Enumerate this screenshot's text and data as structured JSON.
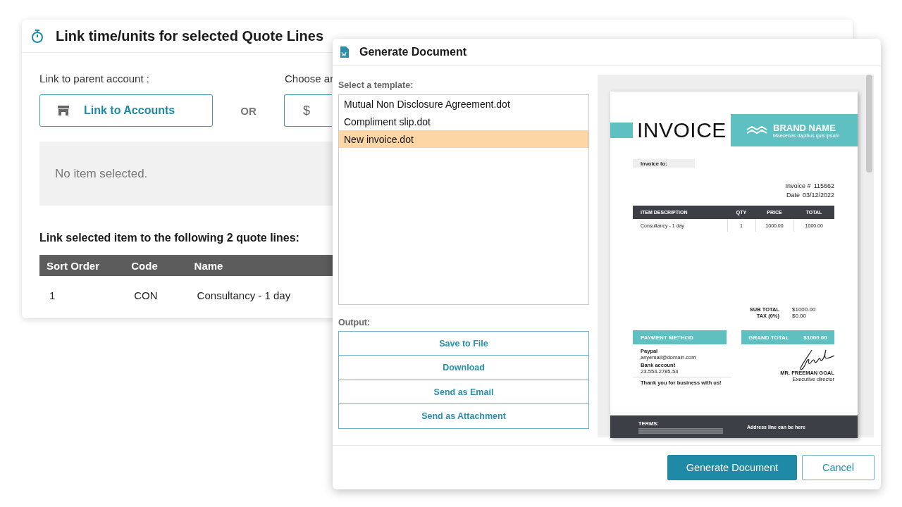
{
  "back_window": {
    "title": "Link time/units for selected Quote Lines",
    "parent_label": "Link to parent account :",
    "link_button": "Link to Accounts",
    "or_label": "OR",
    "choose_label": "Choose ar",
    "currency_button": "$",
    "empty_message": "No item selected.",
    "table_title": "Link selected item to the following 2 quote lines:",
    "table": {
      "columns": [
        "Sort Order",
        "Code",
        "Name"
      ],
      "rows": [
        [
          "1",
          "CON",
          "Consultancy - 1 day"
        ]
      ]
    }
  },
  "dialog": {
    "title": "Generate Document",
    "template_label": "Select a template:",
    "templates": [
      {
        "label": "Mutual Non Disclosure Agreement.dot",
        "selected": false
      },
      {
        "label": "Compliment slip.dot",
        "selected": false
      },
      {
        "label": "New invoice.dot",
        "selected": true
      }
    ],
    "output_label": "Output:",
    "output_buttons": [
      "Save to File",
      "Download",
      "Send as Email",
      "Send as Attachment"
    ],
    "preview": {
      "title": "INVOICE",
      "brand": "BRAND NAME",
      "tagline": "Maecenas dapibus quis ipsum",
      "invoice_to": "Invoice to:",
      "number_label": "Invoice #",
      "number": "115662",
      "date_label": "Date",
      "date": "03/12/2022",
      "columns": [
        "ITEM DESCRIPTION",
        "QTY",
        "PRICE",
        "TOTAL"
      ],
      "rows": [
        [
          "Consultancy - 1 day",
          "1",
          "1000.00",
          "1000.00"
        ]
      ],
      "totals": [
        {
          "label": "SUB TOTAL",
          "value": "$1000.00"
        },
        {
          "label": "TAX (0%)",
          "value": "$0.00"
        }
      ],
      "payment_title": "PAYMENT METHOD",
      "payment": [
        {
          "label": "Paypal",
          "value": "anyemail@domain.com"
        },
        {
          "label": "Bank account",
          "value": "23-554-2785-54"
        }
      ],
      "thanks": "Thank you for business with us!",
      "grand_total_label": "GRAND TOTAL",
      "grand_total": "$1000.00",
      "signer": "MR. FREEMAN GOAL",
      "signer_role": "Executive director",
      "terms_label": "TERMS:",
      "address": "Address line can be here"
    },
    "buttons": [
      {
        "label": "Generate Document",
        "kind": "primary"
      },
      {
        "label": "Cancel",
        "kind": "secondary"
      }
    ]
  }
}
